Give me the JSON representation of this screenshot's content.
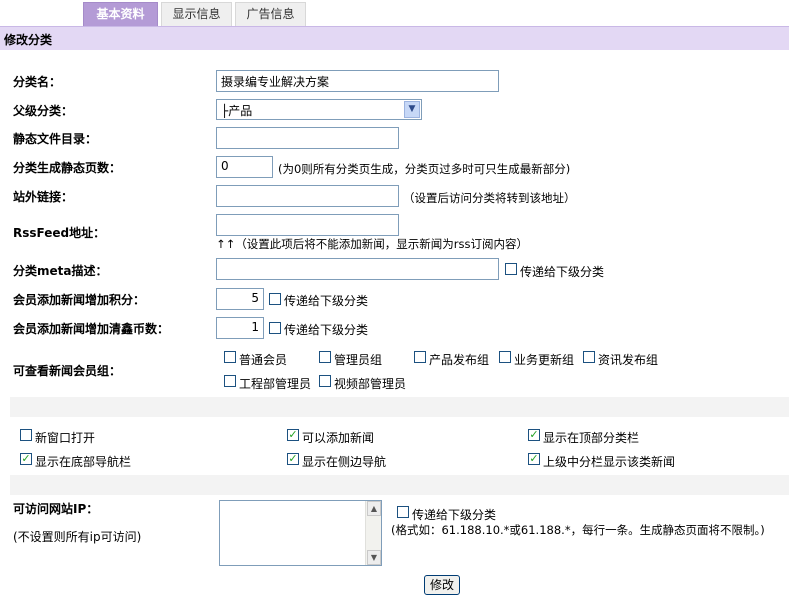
{
  "tabs": [
    "基本资料",
    "显示信息",
    "广告信息"
  ],
  "section_title": "修改分类",
  "fields": {
    "name": {
      "label": "分类名：",
      "value": "摄录编专业解决方案"
    },
    "parent": {
      "label": "父级分类：",
      "value": "├产品"
    },
    "static_dir": {
      "label": "静态文件目录：",
      "value": ""
    },
    "static_pages": {
      "label": "分类生成静态页数：",
      "value": "0",
      "hint": "(为0则所有分类页生成，分类页过多时可只生成最新部分)"
    },
    "external_link": {
      "label": "站外链接：",
      "value": "",
      "hint": "（设置后访问分类将转到该地址）"
    },
    "rss": {
      "label": "RssFeed地址：",
      "value": "",
      "hint": "↑↑（设置此项后将不能添加新闻，显示新闻为rss订阅内容）"
    },
    "meta": {
      "label": "分类meta描述：",
      "value": "",
      "pass_label": "传递给下级分类"
    },
    "points": {
      "label": "会员添加新闻增加积分：",
      "value": "5",
      "pass_label": "传递给下级分类"
    },
    "coins": {
      "label": "会员添加新闻增加清鑫币数：",
      "value": "1",
      "pass_label": "传递给下级分类"
    }
  },
  "groups": {
    "label": "可查看新闻会员组：",
    "items": [
      "普通会员",
      "管理员组",
      "产品发布组",
      "业务更新组",
      "资讯发布组",
      "工程部管理员",
      "视频部管理员"
    ]
  },
  "options": [
    {
      "label": "新窗口打开",
      "checked": false
    },
    {
      "label": "可以添加新闻",
      "checked": true
    },
    {
      "label": "显示在顶部分类栏",
      "checked": true
    },
    {
      "label": "显示在底部导航栏",
      "checked": true
    },
    {
      "label": "显示在侧边导航",
      "checked": true
    },
    {
      "label": "上级中分栏显示该类新闻",
      "checked": true
    }
  ],
  "ip": {
    "label": "可访问网站IP：",
    "note": "(不设置则所有ip可访问)",
    "pass_label": "传递给下级分类",
    "format": "(格式如：61.188.10.*或61.188.*，每行一条。生成静态页面将不限制。)"
  },
  "submit_label": "修改"
}
